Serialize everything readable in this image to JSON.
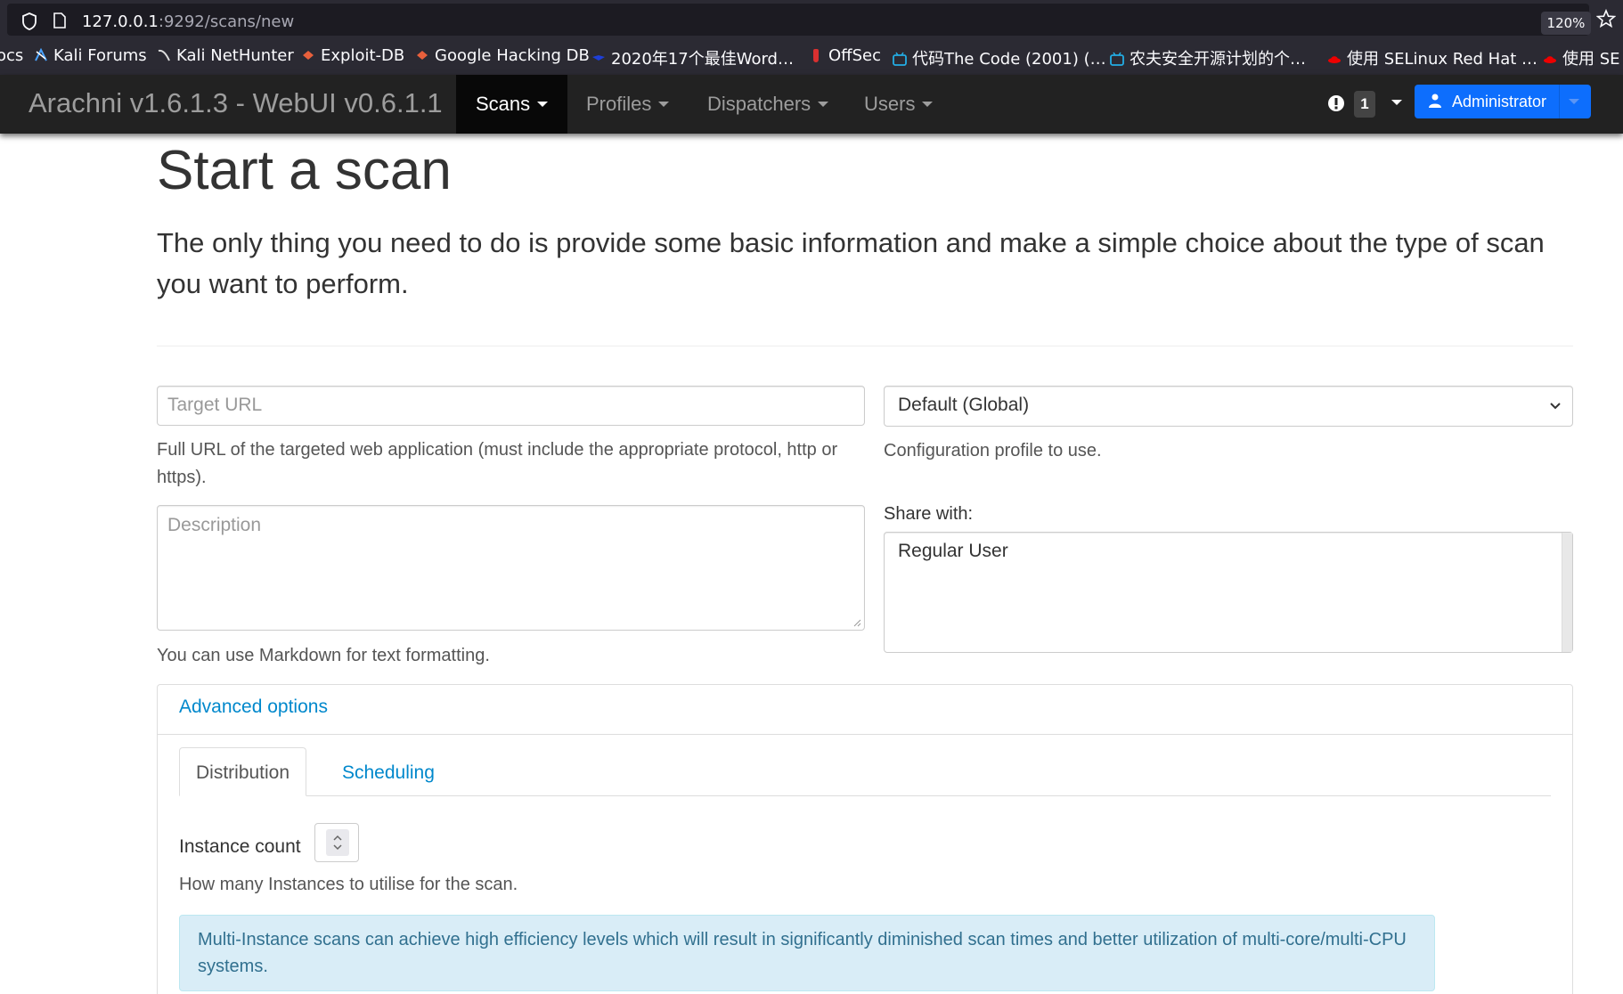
{
  "browser": {
    "url_host": "127.0.0.1",
    "url_rest": ":9292/scans/new",
    "zoom": "120%",
    "bookmarks": [
      {
        "label": "ocs",
        "icon": "none"
      },
      {
        "label": "Kali Forums",
        "icon": "kali-dragon-icon"
      },
      {
        "label": "Kali NetHunter",
        "icon": "nethunter-icon"
      },
      {
        "label": "Exploit-DB",
        "icon": "exploit-db-icon"
      },
      {
        "label": "Google Hacking DB",
        "icon": "ghdb-icon"
      },
      {
        "label": "2020年17个最佳Word…",
        "icon": "wordpress-icon"
      },
      {
        "label": "OffSec",
        "icon": "offsec-icon"
      },
      {
        "label": "代码The Code (2001) (…",
        "icon": "bilibili-icon"
      },
      {
        "label": "农夫安全开源计划的个…",
        "icon": "bilibili-icon"
      },
      {
        "label": "使用 SELinux Red Hat …",
        "icon": "redhat-icon"
      },
      {
        "label": "使用 SE",
        "icon": "redhat-icon"
      }
    ]
  },
  "navbar": {
    "brand": "Arachni v1.6.1.3 - WebUI v0.6.1.1",
    "items": [
      {
        "label": "Scans",
        "active": true
      },
      {
        "label": "Profiles",
        "active": false
      },
      {
        "label": "Dispatchers",
        "active": false
      },
      {
        "label": "Users",
        "active": false
      }
    ],
    "notification_count": "1",
    "user_label": "Administrator"
  },
  "colors": {
    "navbar_bg": "#222222",
    "primary": "#0d6efd",
    "link": "#0088cc",
    "alert_bg": "#d9edf7",
    "alert_text": "#31708f"
  },
  "page": {
    "title": "Start a scan",
    "lead": "The only thing you need to do is provide some basic information and make a simple choice about the type of scan you want to perform."
  },
  "form": {
    "target_url": {
      "value": "",
      "placeholder": "Target URL",
      "help": "Full URL of the targeted web application (must include the appropriate protocol, http or https)."
    },
    "profile": {
      "selected": "Default (Global)",
      "help": "Configuration profile to use."
    },
    "description": {
      "value": "",
      "placeholder": "Description",
      "help": "You can use Markdown for text formatting."
    },
    "share_with": {
      "label": "Share with:",
      "options": [
        "Regular User"
      ]
    }
  },
  "advanced": {
    "heading": "Advanced options",
    "tabs": [
      {
        "label": "Distribution",
        "active": true
      },
      {
        "label": "Scheduling",
        "active": false
      }
    ],
    "instance_count": {
      "label": "Instance count",
      "value": "",
      "help": "How many Instances to utilise for the scan."
    },
    "alert": "Multi-Instance scans can achieve high efficiency levels which will result in significantly diminished scan times and better utilization of multi-core/multi-CPU systems."
  }
}
